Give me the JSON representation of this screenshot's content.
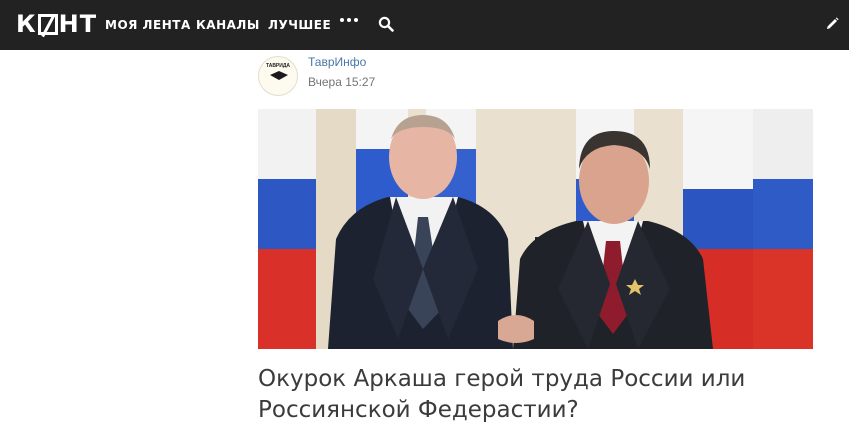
{
  "header": {
    "logo": "КНТ",
    "nav": [
      {
        "label": "МОЯ ЛЕНТА"
      },
      {
        "label": "КАНАЛЫ"
      },
      {
        "label": "ЛУЧШЕЕ"
      }
    ],
    "icons": [
      "more-icon",
      "search-icon",
      "edit-icon"
    ],
    "background": "#222222"
  },
  "post": {
    "source_avatar_text": "ТАВРИДА",
    "source": "ТаврИнфо",
    "time": "Вчера 15:27",
    "title": "Окурок Аркаша герой труда России или Россиянской Федерастии?"
  },
  "colors": {
    "link": "#4a76a8",
    "title": "#3b3b3b",
    "meta": "#757575"
  }
}
